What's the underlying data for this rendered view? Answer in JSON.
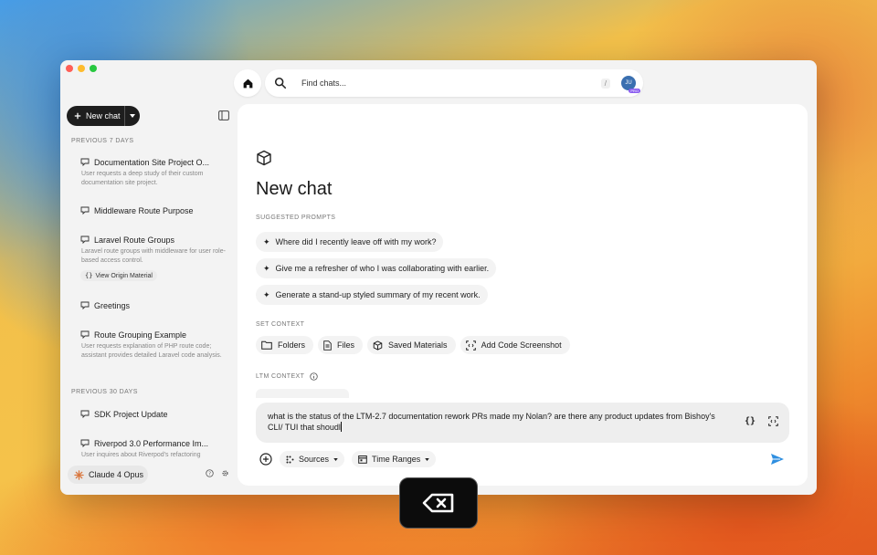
{
  "search": {
    "placeholder": "Find chats...",
    "shortcut": "/"
  },
  "user": {
    "initials": "JU",
    "badge": "PRO"
  },
  "sidebar": {
    "new_chat_label": "New chat",
    "section_7_days": "PREVIOUS 7 DAYS",
    "section_30_days": "PREVIOUS 30 DAYS",
    "items": [
      {
        "title": "Documentation Site Project O...",
        "desc": "User requests a deep study of their custom documentation site project."
      },
      {
        "title": "Middleware Route Purpose",
        "desc": ""
      },
      {
        "title": "Laravel Route Groups",
        "desc": "Laravel route groups with middleware for user role-based access control.",
        "chip": "View Origin Material"
      },
      {
        "title": "Greetings",
        "desc": ""
      },
      {
        "title": "Route Grouping Example",
        "desc": "User requests explanation of PHP route code; assistant provides detailed Laravel code analysis."
      },
      {
        "title": "SDK Project Update",
        "desc": ""
      },
      {
        "title": "Riverpod 3.0 Performance Im...",
        "desc": "User inquires about Riverpod's refactoring"
      }
    ],
    "model_label": "Claude 4 Opus"
  },
  "main": {
    "title": "New chat",
    "suggested_label": "SUGGESTED PROMPTS",
    "prompts": [
      "Where did I recently leave off with my work?",
      "Give me a refresher of who I was collaborating with earlier.",
      "Generate a stand-up styled summary of my recent work."
    ],
    "context_label": "SET CONTEXT",
    "context_buttons": [
      "Folders",
      "Files",
      "Saved Materials",
      "Add Code Screenshot"
    ],
    "ltm_label": "LTM CONTEXT",
    "input_text": "what is the status of the LTM-2.7 documentation rework PRs made my Nolan? are there any product updates from Bishoy's CLI/ TUI that shoudl",
    "sources_label": "Sources",
    "time_ranges_label": "Time Ranges"
  },
  "colors": {
    "accent": "#2f8fe0",
    "dark_button": "#1e1e1e"
  }
}
